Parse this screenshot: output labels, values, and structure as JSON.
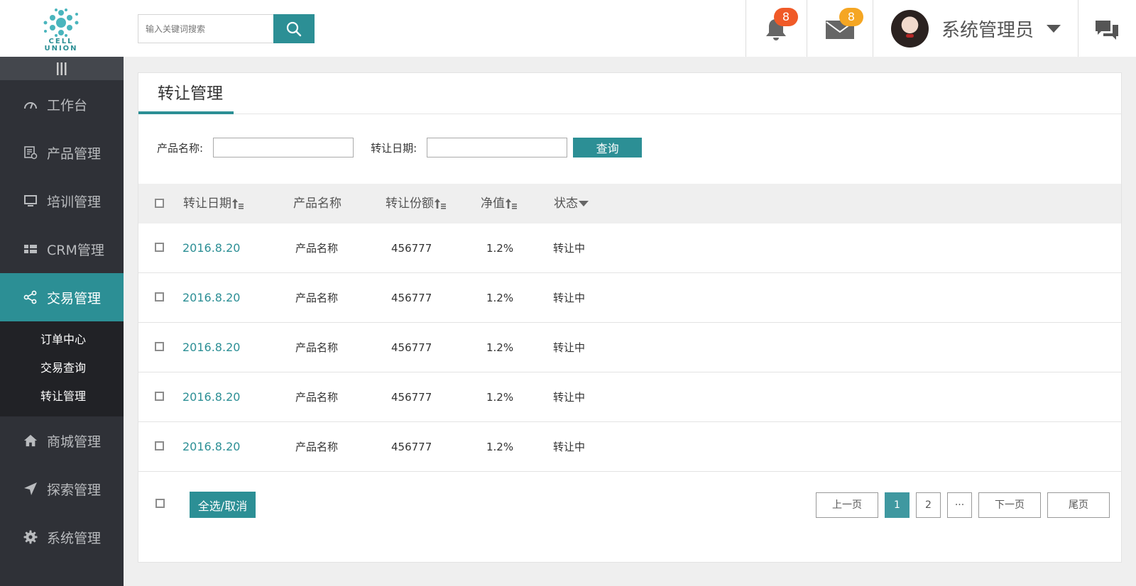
{
  "header": {
    "logo_text": [
      "CELL",
      "UNION"
    ],
    "search": {
      "placeholder": "输入关键词搜索",
      "value": ""
    },
    "notifications": {
      "icon": "bell-icon",
      "count": "8",
      "color": "#f05a28"
    },
    "messages": {
      "icon": "mail-icon",
      "count": "8",
      "color": "#f5a623"
    },
    "user": {
      "name": "系统管理员"
    }
  },
  "sidebar": {
    "items": [
      {
        "label": "工作台",
        "icon": "gauge-icon"
      },
      {
        "label": "产品管理",
        "icon": "product-list-icon"
      },
      {
        "label": "培训管理",
        "icon": "monitor-icon"
      },
      {
        "label": "CRM管理",
        "icon": "grid-icon"
      },
      {
        "label": "交易管理",
        "icon": "share-icon",
        "active": true
      },
      {
        "label": "商城管理",
        "icon": "home-icon"
      },
      {
        "label": "探索管理",
        "icon": "paper-plane-icon"
      },
      {
        "label": "系统管理",
        "icon": "gear-icon"
      }
    ],
    "subitems": [
      "订单中心",
      "交易查询",
      "转让管理"
    ]
  },
  "main": {
    "title": "转让管理",
    "filters": {
      "product_label": "产品名称:",
      "product_value": "",
      "date_label": "转让日期:",
      "date_value": "",
      "query_label": "查询"
    },
    "columns": [
      "转让日期",
      "产品名称",
      "转让份额",
      "净值",
      "状态"
    ],
    "rows": [
      {
        "date": "2016.8.20",
        "product": "产品名称",
        "share": "456777",
        "nav": "1.2%",
        "status": "转让中"
      },
      {
        "date": "2016.8.20",
        "product": "产品名称",
        "share": "456777",
        "nav": "1.2%",
        "status": "转让中"
      },
      {
        "date": "2016.8.20",
        "product": "产品名称",
        "share": "456777",
        "nav": "1.2%",
        "status": "转让中"
      },
      {
        "date": "2016.8.20",
        "product": "产品名称",
        "share": "456777",
        "nav": "1.2%",
        "status": "转让中"
      },
      {
        "date": "2016.8.20",
        "product": "产品名称",
        "share": "456777",
        "nav": "1.2%",
        "status": "转让中"
      }
    ],
    "select_all_label": "全选/取消",
    "pagination": {
      "prev": "上一页",
      "pages": [
        "1",
        "2"
      ],
      "ellipsis": "···",
      "next": "下一页",
      "last": "尾页",
      "current": "1"
    }
  },
  "colors": {
    "accent": "#2c8f95",
    "sidebar_bg": "#2f3137",
    "submenu_bg": "#212226"
  }
}
